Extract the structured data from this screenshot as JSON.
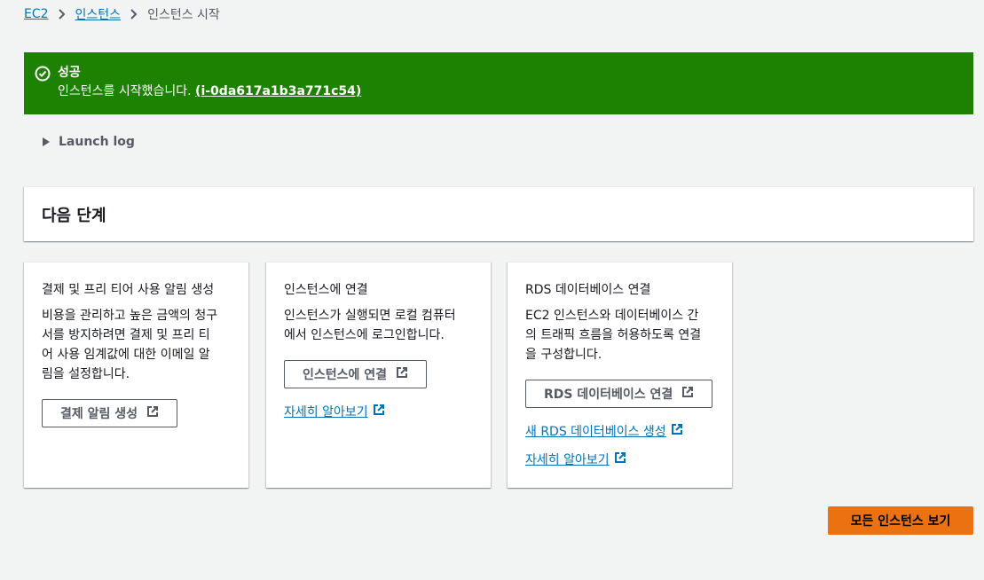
{
  "breadcrumb": {
    "items": [
      "EC2",
      "인스턴스"
    ],
    "current": "인스턴스 시작"
  },
  "flash": {
    "title": "성공",
    "message": "인스턴스를 시작했습니다.",
    "instance_link": "(i-0da617a1b3a771c54)",
    "icon": "check-circle-icon",
    "color": "#1d8102"
  },
  "launch_log": {
    "label": "Launch log"
  },
  "next_steps": {
    "title": "다음 단계"
  },
  "cards": [
    {
      "title": "결제 및 프리 티어 사용 알림 생성",
      "body_lines": [
        "비용을 관리하고 높은 금액의 청구",
        "서를 방지하려면 결제 및 프리 티",
        "어 사용 임계값에 대한 이메일 알",
        "림을 설정합니다."
      ],
      "button": "결제 알림 생성"
    },
    {
      "title": "인스턴스에 연결",
      "body_lines": [
        "인스턴스가 실행되면 로컬 컴퓨터",
        "에서 인스턴스에 로그인합니다."
      ],
      "button": "인스턴스에 연결",
      "link": "자세히 알아보기"
    },
    {
      "title": "RDS 데이터베이스 연결",
      "body_lines": [
        "EC2 인스턴스와 데이터베이스 간",
        "의 트래픽 흐름을 허용하도록 연결",
        "을 구성합니다."
      ],
      "button": "RDS 데이터베이스 연결",
      "link1": "새 RDS 데이터베이스 생성",
      "link2": "자세히 알아보기"
    }
  ],
  "primary_button": {
    "label": "모든 인스턴스 보기",
    "color": "#ec7211"
  },
  "colors": {
    "link": "#0073bb",
    "background": "#f2f3f3"
  }
}
